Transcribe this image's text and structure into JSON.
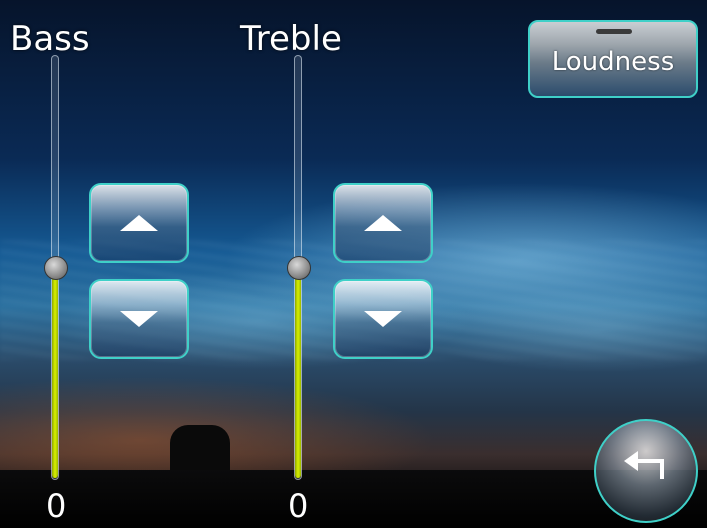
{
  "labels": {
    "bass": "Bass",
    "treble": "Treble"
  },
  "values": {
    "bass": "0",
    "treble": "0"
  },
  "loudness": {
    "label": "Loudness"
  },
  "sliders": {
    "bass": {
      "level_fraction": 0.5
    },
    "treble": {
      "level_fraction": 0.5
    }
  },
  "icons": {
    "up": "triangle-up-icon",
    "down": "triangle-down-icon",
    "back": "return-arrow-icon"
  },
  "colors": {
    "accent": "#3fd0c8",
    "level_fill": "#d8f000",
    "text": "#ffffff"
  }
}
